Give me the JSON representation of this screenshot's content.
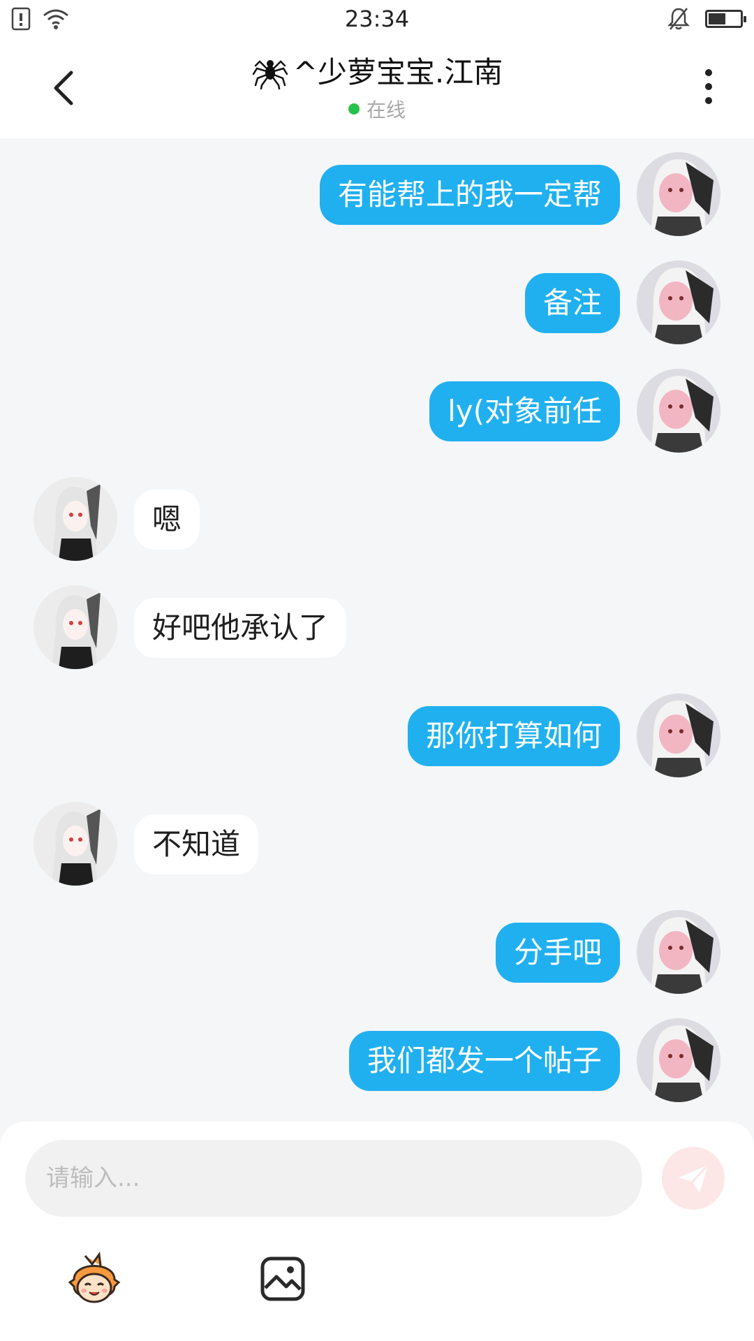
{
  "status_bar": {
    "time": "23:34"
  },
  "header": {
    "title": "^少萝宝宝.江南",
    "status": "在线"
  },
  "messages": [
    {
      "side": "me",
      "text": "有能帮上的我一定帮"
    },
    {
      "side": "me",
      "text": "备注"
    },
    {
      "side": "me",
      "text": "ly(对象前任"
    },
    {
      "side": "them",
      "text": "嗯"
    },
    {
      "side": "them",
      "text": "好吧他承认了"
    },
    {
      "side": "me",
      "text": "那你打算如何"
    },
    {
      "side": "them",
      "text": "不知道"
    },
    {
      "side": "me",
      "text": "分手吧"
    },
    {
      "side": "me",
      "text": "我们都发一个帖子"
    }
  ],
  "composer": {
    "placeholder": "请输入..."
  },
  "icons": {
    "back": "chevron-left-icon",
    "more": "more-vertical-icon",
    "send": "paper-plane-icon",
    "emoji": "emoji-mascot-icon",
    "image": "image-icon"
  },
  "colors": {
    "my_bubble": "#20b0f0",
    "their_bubble": "#ffffff",
    "online": "#27c24c",
    "send_button_disabled": "#fde6e6"
  }
}
